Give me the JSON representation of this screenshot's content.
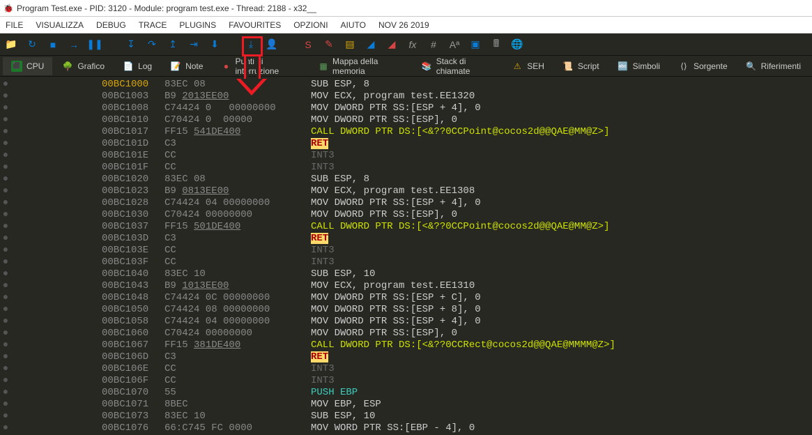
{
  "window": {
    "title": "Program Test.exe - PID: 3120 - Module: program test.exe - Thread: 2188 - x32__"
  },
  "menu": {
    "file": "FILE",
    "visualizza": "VISUALIZZA",
    "debug": "DEBUG",
    "trace": "TRACE",
    "plugins": "PLUGINS",
    "favourites": "FAVOURITES",
    "opzioni": "OPZIONI",
    "aiuto": "AIUTO",
    "date": "NOV 26 2019"
  },
  "tabs": {
    "cpu": "CPU",
    "grafico": "Grafico",
    "log": "Log",
    "note": "Note",
    "punti": "Punti di interruzione",
    "mappa": "Mappa della memoria",
    "stack": "Stack di chiamate",
    "seh": "SEH",
    "script": "Script",
    "simboli": "Simboli",
    "sorgente": "Sorgente",
    "riferimenti": "Riferimenti"
  },
  "disasm": [
    {
      "bp": "●",
      "addr": "00BC1000",
      "addr_hl": true,
      "bytes": "83EC 08",
      "instr": "SUB ESP, 8",
      "cls": ""
    },
    {
      "bp": "●",
      "addr": "00BC1003",
      "bytes": "B9 <u>2013EE00</u>",
      "instr": "MOV ECX, program test.EE1320",
      "cls": ""
    },
    {
      "bp": "●",
      "addr": "00BC1008",
      "bytes": "C74424 0   00000000",
      "instr": "MOV DWORD PTR SS:[ESP + 4], 0",
      "cls": ""
    },
    {
      "bp": "●",
      "addr": "00BC1010",
      "bytes": "C70424 0  00000",
      "instr": "MOV DWORD PTR SS:[ESP], 0",
      "cls": ""
    },
    {
      "bp": "●",
      "addr": "00BC1017",
      "bytes": "FF15 <u>541DE400</u>",
      "instr": "CALL DWORD PTR DS:[<&??0CCPoint@cocos2d@@QAE@MM@Z>]",
      "cls": "call"
    },
    {
      "bp": "●",
      "addr": "00BC101D",
      "bytes": "C3",
      "instr": "RET",
      "cls": "ret"
    },
    {
      "bp": "●",
      "addr": "00BC101E",
      "bytes": "CC",
      "instr": "INT3",
      "cls": "int3"
    },
    {
      "bp": "●",
      "addr": "00BC101F",
      "bytes": "CC",
      "instr": "INT3",
      "cls": "int3"
    },
    {
      "bp": "●",
      "addr": "00BC1020",
      "bytes": "83EC 08",
      "instr": "SUB ESP, 8",
      "cls": ""
    },
    {
      "bp": "●",
      "addr": "00BC1023",
      "bytes": "B9 <u>0813EE00</u>",
      "instr": "MOV ECX, program test.EE1308",
      "cls": ""
    },
    {
      "bp": "●",
      "addr": "00BC1028",
      "bytes": "C74424 04 00000000",
      "instr": "MOV DWORD PTR SS:[ESP + 4], 0",
      "cls": ""
    },
    {
      "bp": "●",
      "addr": "00BC1030",
      "bytes": "C70424 00000000",
      "instr": "MOV DWORD PTR SS:[ESP], 0",
      "cls": ""
    },
    {
      "bp": "●",
      "addr": "00BC1037",
      "bytes": "FF15 <u>501DE400</u>",
      "instr": "CALL DWORD PTR DS:[<&??0CCPoint@cocos2d@@QAE@MM@Z>]",
      "cls": "call"
    },
    {
      "bp": "●",
      "addr": "00BC103D",
      "bytes": "C3",
      "instr": "RET",
      "cls": "ret"
    },
    {
      "bp": "●",
      "addr": "00BC103E",
      "bytes": "CC",
      "instr": "INT3",
      "cls": "int3"
    },
    {
      "bp": "●",
      "addr": "00BC103F",
      "bytes": "CC",
      "instr": "INT3",
      "cls": "int3"
    },
    {
      "bp": "●",
      "addr": "00BC1040",
      "bytes": "83EC 10",
      "instr": "SUB ESP, 10",
      "cls": ""
    },
    {
      "bp": "●",
      "addr": "00BC1043",
      "bytes": "B9 <u>1013EE00</u>",
      "instr": "MOV ECX, program test.EE1310",
      "cls": ""
    },
    {
      "bp": "●",
      "addr": "00BC1048",
      "bytes": "C74424 0C 00000000",
      "instr": "MOV DWORD PTR SS:[ESP + C], 0",
      "cls": ""
    },
    {
      "bp": "●",
      "addr": "00BC1050",
      "bytes": "C74424 08 00000000",
      "instr": "MOV DWORD PTR SS:[ESP + 8], 0",
      "cls": ""
    },
    {
      "bp": "●",
      "addr": "00BC1058",
      "bytes": "C74424 04 00000000",
      "instr": "MOV DWORD PTR SS:[ESP + 4], 0",
      "cls": ""
    },
    {
      "bp": "●",
      "addr": "00BC1060",
      "bytes": "C70424 00000000",
      "instr": "MOV DWORD PTR SS:[ESP], 0",
      "cls": ""
    },
    {
      "bp": "●",
      "addr": "00BC1067",
      "bytes": "FF15 <u>381DE400</u>",
      "instr": "CALL DWORD PTR DS:[<&??0CCRect@cocos2d@@QAE@MMMM@Z>]",
      "cls": "call"
    },
    {
      "bp": "●",
      "addr": "00BC106D",
      "bytes": "C3",
      "instr": "RET",
      "cls": "ret"
    },
    {
      "bp": "●",
      "addr": "00BC106E",
      "bytes": "CC",
      "instr": "INT3",
      "cls": "int3"
    },
    {
      "bp": "●",
      "addr": "00BC106F",
      "bytes": "CC",
      "instr": "INT3",
      "cls": "int3"
    },
    {
      "bp": "●",
      "addr": "00BC1070",
      "bytes": "55",
      "instr": "PUSH EBP",
      "cls": "push"
    },
    {
      "bp": "●",
      "addr": "00BC1071",
      "bytes": "8BEC",
      "instr": "MOV EBP, ESP",
      "cls": ""
    },
    {
      "bp": "●",
      "addr": "00BC1073",
      "bytes": "83EC 10",
      "instr": "SUB ESP, 10",
      "cls": ""
    },
    {
      "bp": "●",
      "addr": "00BC1076",
      "bytes": "66:C745 FC 0000",
      "instr": "MOV WORD PTR SS:[EBP - 4], 0",
      "cls": ""
    }
  ]
}
